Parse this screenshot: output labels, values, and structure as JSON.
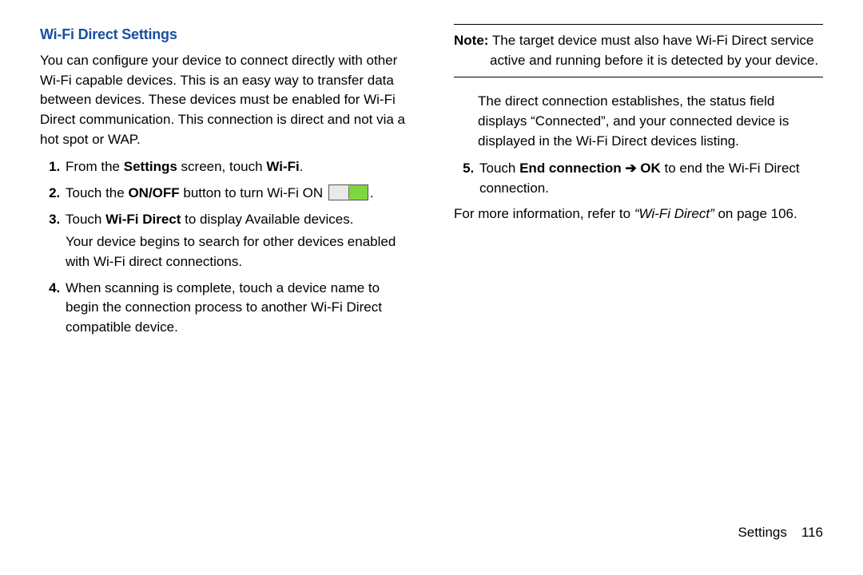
{
  "heading": "Wi-Fi Direct Settings",
  "intro": "You can configure your device to connect directly with other Wi-Fi capable devices. This is an easy way to transfer data between devices. These devices must be enabled for Wi-Fi Direct communication. This connection is direct and not via a hot spot or WAP.",
  "steps": {
    "s1a": "From the ",
    "s1b": "Settings",
    "s1c": " screen, touch ",
    "s1d": "Wi-Fi",
    "s1e": ".",
    "s2a": "Touch the ",
    "s2b": "ON/OFF",
    "s2c": " button to turn Wi-Fi ON ",
    "s2d": ".",
    "s3a": "Touch ",
    "s3b": "Wi-Fi Direct",
    "s3c": " to display Available devices.",
    "s3sub": "Your device begins to search for other devices enabled with Wi-Fi direct connections.",
    "s4": "When scanning is complete, touch a device name to begin the connection process to another Wi-Fi Direct compatible device."
  },
  "note": {
    "label": "Note:",
    "text": " The target device must also have Wi-Fi Direct service active and running before it is detected by your device."
  },
  "right": {
    "para": "The direct connection establishes, the status field displays “Connected”, and your connected device is displayed in the Wi-Fi Direct devices listing.",
    "s5a": "Touch ",
    "s5b": "End connection",
    "s5c": " ➔ ",
    "s5d": "OK",
    "s5e": " to end the Wi-Fi Direct connection.",
    "more_a": "For more information, refer to ",
    "more_b": "“Wi-Fi Direct”",
    "more_c": " on page 106."
  },
  "footer": {
    "section": "Settings",
    "page": "116"
  }
}
